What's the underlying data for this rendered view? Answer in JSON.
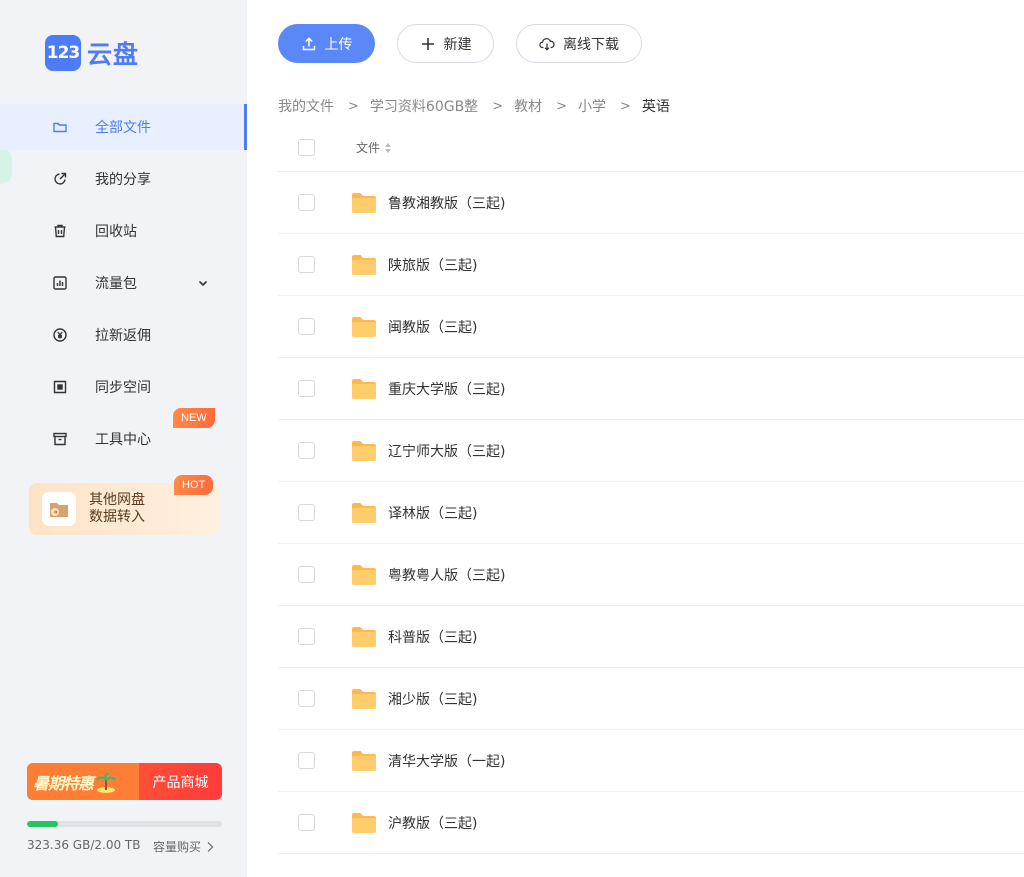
{
  "app": {
    "logo_badge": "123",
    "logo_text": "云盘"
  },
  "sidebar": {
    "items": [
      {
        "label": "全部文件",
        "icon": "folder-icon",
        "active": true
      },
      {
        "label": "我的分享",
        "icon": "share-icon",
        "active": false
      },
      {
        "label": "回收站",
        "icon": "trash-icon",
        "active": false
      },
      {
        "label": "流量包",
        "icon": "chart-icon",
        "active": false,
        "expandable": true
      },
      {
        "label": "拉新返佣",
        "icon": "yen-icon",
        "active": false
      },
      {
        "label": "同步空间",
        "icon": "sync-icon",
        "active": false
      },
      {
        "label": "工具中心",
        "icon": "toolbox-icon",
        "active": false,
        "badge": "NEW"
      }
    ],
    "promo": {
      "line1": "其他网盘",
      "line2": "数据转入",
      "badge": "HOT"
    },
    "sale_banner": {
      "left_text": "暑期特惠",
      "right_text": "产品商城"
    },
    "storage": {
      "used_text": "323.36 GB/2.00 TB",
      "used_fraction": 0.16,
      "buy_label": "容量购买"
    }
  },
  "toolbar": {
    "upload_label": "上传",
    "new_label": "新建",
    "offline_label": "离线下载"
  },
  "breadcrumb": [
    "我的文件",
    "学习资料60GB整",
    "教材",
    "小学",
    "英语"
  ],
  "table": {
    "column_name": "文件",
    "rows": [
      "鲁教湘教版（三起)",
      "陕旅版（三起)",
      "闽教版（三起)",
      "重庆大学版（三起)",
      "辽宁师大版（三起)",
      "译林版（三起)",
      "粤教粤人版（三起)",
      "科普版（三起)",
      "湘少版（三起)",
      "清华大学版（一起)",
      "沪教版（三起)"
    ]
  },
  "colors": {
    "accent": "#4e7bf6",
    "folder": "#ffc65c",
    "badge": "#ff7a45",
    "storage": "#22c55e"
  }
}
